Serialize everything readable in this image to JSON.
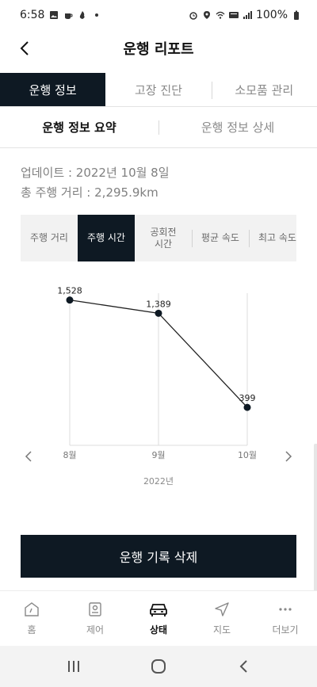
{
  "status_bar": {
    "time": "6:58",
    "battery": "100%",
    "icons_left": [
      "gallery-icon",
      "coffee-icon",
      "fire-icon",
      "dot-icon"
    ],
    "icons_right": [
      "alarm-icon",
      "location-icon",
      "wifi-icon",
      "hd-voice-icon",
      "signal-icon",
      "battery-icon"
    ]
  },
  "header": {
    "title": "운행 리포트"
  },
  "main_tabs": [
    {
      "label": "운행 정보",
      "active": true
    },
    {
      "label": "고장 진단",
      "active": false
    },
    {
      "label": "소모품 관리",
      "active": false
    }
  ],
  "sub_tabs": [
    {
      "label": "운행 정보 요약",
      "active": true
    },
    {
      "label": "운행 정보 상세",
      "active": false
    }
  ],
  "info": {
    "update": "업데이트 : 2022년 10월 8일",
    "total_distance": "총 주행 거리 : 2,295.9km"
  },
  "metric_tabs": [
    {
      "label": "주행 거리",
      "active": false
    },
    {
      "label": "주행 시간",
      "active": true
    },
    {
      "label": "공회전\n시간",
      "active": false
    },
    {
      "label": "평균 속도",
      "active": false
    },
    {
      "label": "최고 속도",
      "active": false
    }
  ],
  "chart_data": {
    "type": "line",
    "categories": [
      "8월",
      "9월",
      "10월"
    ],
    "values": [
      1528,
      1389,
      399
    ],
    "value_labels": [
      "1,528",
      "1,389",
      "399"
    ],
    "xlabel": "2022년",
    "ylabel": "",
    "ylim": [
      0,
      1600
    ],
    "grid": "vertical",
    "line_color": "#222222"
  },
  "actions": {
    "delete_label": "운행 기록 삭제"
  },
  "bottom_nav": [
    {
      "label": "홈",
      "icon": "home-icon",
      "active": false
    },
    {
      "label": "제어",
      "icon": "control-icon",
      "active": false
    },
    {
      "label": "상태",
      "icon": "car-icon",
      "active": true
    },
    {
      "label": "지도",
      "icon": "navigation-icon",
      "active": false
    },
    {
      "label": "더보기",
      "icon": "more-icon",
      "active": false
    }
  ],
  "colors": {
    "accent": "#0e1923",
    "inactive_text": "#8a8a8a"
  }
}
